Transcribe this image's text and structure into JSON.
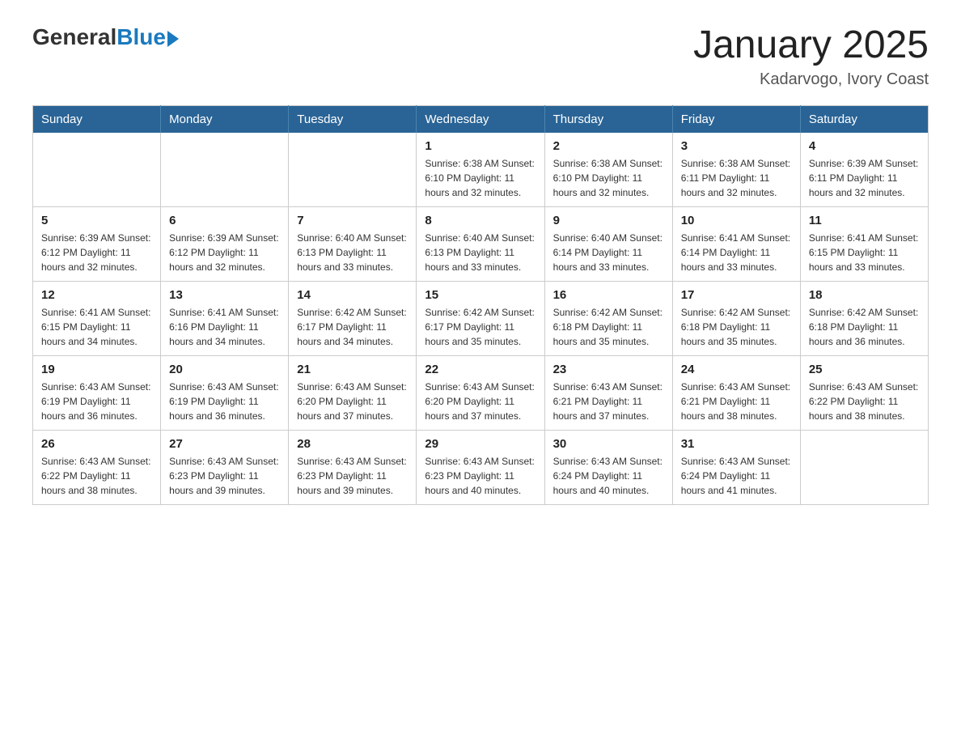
{
  "header": {
    "logo": {
      "general": "General",
      "blue": "Blue"
    },
    "title": "January 2025",
    "location": "Kadarvogo, Ivory Coast"
  },
  "days_of_week": [
    "Sunday",
    "Monday",
    "Tuesday",
    "Wednesday",
    "Thursday",
    "Friday",
    "Saturday"
  ],
  "weeks": [
    [
      {
        "day": "",
        "info": ""
      },
      {
        "day": "",
        "info": ""
      },
      {
        "day": "",
        "info": ""
      },
      {
        "day": "1",
        "info": "Sunrise: 6:38 AM\nSunset: 6:10 PM\nDaylight: 11 hours\nand 32 minutes."
      },
      {
        "day": "2",
        "info": "Sunrise: 6:38 AM\nSunset: 6:10 PM\nDaylight: 11 hours\nand 32 minutes."
      },
      {
        "day": "3",
        "info": "Sunrise: 6:38 AM\nSunset: 6:11 PM\nDaylight: 11 hours\nand 32 minutes."
      },
      {
        "day": "4",
        "info": "Sunrise: 6:39 AM\nSunset: 6:11 PM\nDaylight: 11 hours\nand 32 minutes."
      }
    ],
    [
      {
        "day": "5",
        "info": "Sunrise: 6:39 AM\nSunset: 6:12 PM\nDaylight: 11 hours\nand 32 minutes."
      },
      {
        "day": "6",
        "info": "Sunrise: 6:39 AM\nSunset: 6:12 PM\nDaylight: 11 hours\nand 32 minutes."
      },
      {
        "day": "7",
        "info": "Sunrise: 6:40 AM\nSunset: 6:13 PM\nDaylight: 11 hours\nand 33 minutes."
      },
      {
        "day": "8",
        "info": "Sunrise: 6:40 AM\nSunset: 6:13 PM\nDaylight: 11 hours\nand 33 minutes."
      },
      {
        "day": "9",
        "info": "Sunrise: 6:40 AM\nSunset: 6:14 PM\nDaylight: 11 hours\nand 33 minutes."
      },
      {
        "day": "10",
        "info": "Sunrise: 6:41 AM\nSunset: 6:14 PM\nDaylight: 11 hours\nand 33 minutes."
      },
      {
        "day": "11",
        "info": "Sunrise: 6:41 AM\nSunset: 6:15 PM\nDaylight: 11 hours\nand 33 minutes."
      }
    ],
    [
      {
        "day": "12",
        "info": "Sunrise: 6:41 AM\nSunset: 6:15 PM\nDaylight: 11 hours\nand 34 minutes."
      },
      {
        "day": "13",
        "info": "Sunrise: 6:41 AM\nSunset: 6:16 PM\nDaylight: 11 hours\nand 34 minutes."
      },
      {
        "day": "14",
        "info": "Sunrise: 6:42 AM\nSunset: 6:17 PM\nDaylight: 11 hours\nand 34 minutes."
      },
      {
        "day": "15",
        "info": "Sunrise: 6:42 AM\nSunset: 6:17 PM\nDaylight: 11 hours\nand 35 minutes."
      },
      {
        "day": "16",
        "info": "Sunrise: 6:42 AM\nSunset: 6:18 PM\nDaylight: 11 hours\nand 35 minutes."
      },
      {
        "day": "17",
        "info": "Sunrise: 6:42 AM\nSunset: 6:18 PM\nDaylight: 11 hours\nand 35 minutes."
      },
      {
        "day": "18",
        "info": "Sunrise: 6:42 AM\nSunset: 6:18 PM\nDaylight: 11 hours\nand 36 minutes."
      }
    ],
    [
      {
        "day": "19",
        "info": "Sunrise: 6:43 AM\nSunset: 6:19 PM\nDaylight: 11 hours\nand 36 minutes."
      },
      {
        "day": "20",
        "info": "Sunrise: 6:43 AM\nSunset: 6:19 PM\nDaylight: 11 hours\nand 36 minutes."
      },
      {
        "day": "21",
        "info": "Sunrise: 6:43 AM\nSunset: 6:20 PM\nDaylight: 11 hours\nand 37 minutes."
      },
      {
        "day": "22",
        "info": "Sunrise: 6:43 AM\nSunset: 6:20 PM\nDaylight: 11 hours\nand 37 minutes."
      },
      {
        "day": "23",
        "info": "Sunrise: 6:43 AM\nSunset: 6:21 PM\nDaylight: 11 hours\nand 37 minutes."
      },
      {
        "day": "24",
        "info": "Sunrise: 6:43 AM\nSunset: 6:21 PM\nDaylight: 11 hours\nand 38 minutes."
      },
      {
        "day": "25",
        "info": "Sunrise: 6:43 AM\nSunset: 6:22 PM\nDaylight: 11 hours\nand 38 minutes."
      }
    ],
    [
      {
        "day": "26",
        "info": "Sunrise: 6:43 AM\nSunset: 6:22 PM\nDaylight: 11 hours\nand 38 minutes."
      },
      {
        "day": "27",
        "info": "Sunrise: 6:43 AM\nSunset: 6:23 PM\nDaylight: 11 hours\nand 39 minutes."
      },
      {
        "day": "28",
        "info": "Sunrise: 6:43 AM\nSunset: 6:23 PM\nDaylight: 11 hours\nand 39 minutes."
      },
      {
        "day": "29",
        "info": "Sunrise: 6:43 AM\nSunset: 6:23 PM\nDaylight: 11 hours\nand 40 minutes."
      },
      {
        "day": "30",
        "info": "Sunrise: 6:43 AM\nSunset: 6:24 PM\nDaylight: 11 hours\nand 40 minutes."
      },
      {
        "day": "31",
        "info": "Sunrise: 6:43 AM\nSunset: 6:24 PM\nDaylight: 11 hours\nand 41 minutes."
      },
      {
        "day": "",
        "info": ""
      }
    ]
  ]
}
